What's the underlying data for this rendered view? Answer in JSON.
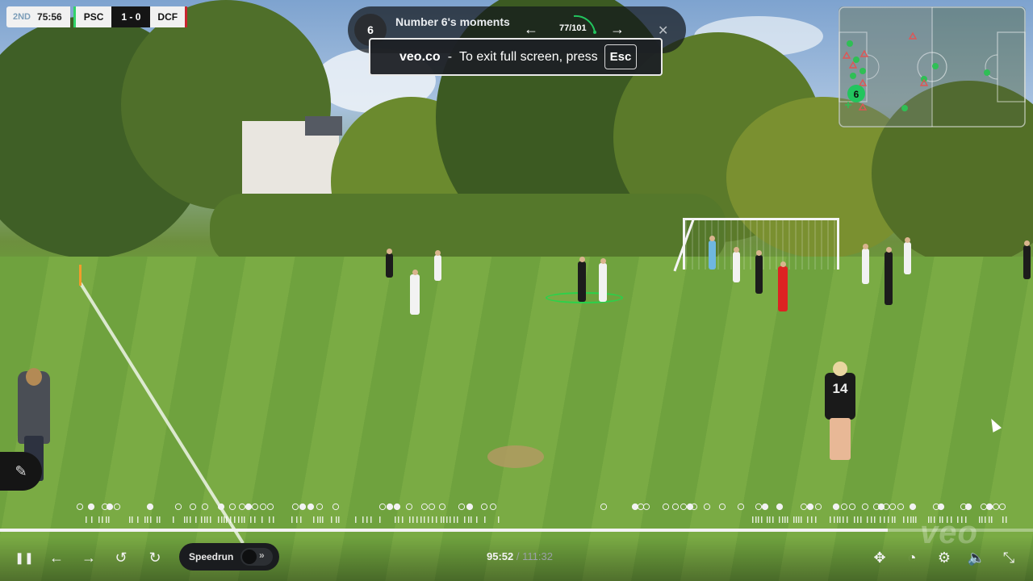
{
  "scoreboard": {
    "period": "2ND",
    "clock": "75:56",
    "home_team": "PSC",
    "score": "1 - 0",
    "away_team": "DCF",
    "home_color": "#31d26a",
    "away_color": "#c8252f"
  },
  "moments": {
    "player_number": "6",
    "title": "Number 6's moments",
    "counter": "77/101",
    "prev_icon": "arrow-left-icon",
    "next_icon": "arrow-right-icon",
    "close_icon": "close-icon"
  },
  "toast": {
    "site": "veo.co",
    "separator": "-",
    "message": "To exit full screen, press",
    "key": "Esc"
  },
  "minimap": {
    "highlight_player": "6",
    "highlight_color": "#22c55e"
  },
  "side_tab": {
    "icon": "draw-icon",
    "glyph": "✎"
  },
  "jersey": {
    "number": "14"
  },
  "timeline": {
    "progress_fraction": 0.859,
    "current_time": "95:52",
    "separator": "/",
    "duration": "111:32"
  },
  "watermark": "veo",
  "controls": {
    "pause": {
      "icon": "pause-icon",
      "glyph": "❚❚"
    },
    "prev": {
      "icon": "arrow-left-icon",
      "glyph": "←"
    },
    "next": {
      "icon": "arrow-right-icon",
      "glyph": "→"
    },
    "rewind": {
      "icon": "rewind-5-icon",
      "glyph": "↺"
    },
    "forward": {
      "icon": "forward-5-icon",
      "glyph": "↻"
    },
    "speedrun_label": "Speedrun",
    "speedrun_chevron": "»",
    "move": {
      "icon": "move-icon",
      "glyph": "✥"
    },
    "speed": {
      "icon": "speedometer-icon",
      "glyph": "◔"
    },
    "settings": {
      "icon": "gear-icon",
      "glyph": "⚙"
    },
    "volume": {
      "icon": "volume-icon",
      "glyph": "🔈"
    },
    "exit_fullscreen": {
      "icon": "exit-fullscreen-icon",
      "glyph": "⤡"
    }
  }
}
